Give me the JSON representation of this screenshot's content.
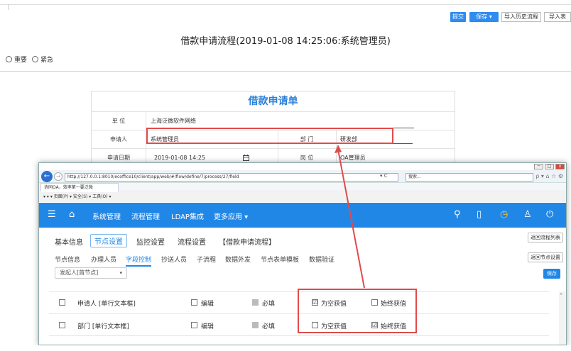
{
  "toolbar": {
    "submit": "提交",
    "save": "保存",
    "save_caret": "▾",
    "import_history": "导入历史流程",
    "import_next": "导入表"
  },
  "page": {
    "title": "借款申请流程(2019-01-08 14:25:06:系统管理员)",
    "radio_important": "重要",
    "radio_urgent": "紧急"
  },
  "form": {
    "heading": "借款申请单",
    "unit_label": "单  位",
    "unit_value": "上海泛微软件网络",
    "applicant_label": "申请人",
    "applicant_value": "系统管理员",
    "dept_label": "部  门",
    "dept_value": "研发部",
    "date_label": "申请日期",
    "date_value": "2019-01-08 14:25",
    "post_label": "岗  位",
    "post_value": "OA管理员"
  },
  "browser": {
    "url": "http://127.0.0.1:8010/ecoffice10/client/app/web/#/flow/define/7/process/27/field",
    "url_tools": "▾ C",
    "search": "搜索...",
    "search_tools": "ρ ▾",
    "tab_title": "协同OA，效率第一要泛微",
    "menu": "▾  ▾  ▾  页面(P) ▾  安全(S) ▾  工具(O) ▾",
    "win_min": "─",
    "win_max": "□",
    "win_close": "x"
  },
  "navbar": {
    "items": [
      "系统管理",
      "流程管理",
      "LDAP集成",
      "更多应用 ▾"
    ],
    "home_icon": "home-icon",
    "menu_icon": "menu-icon"
  },
  "tabs1": {
    "items": [
      "基本信息",
      "节点设置",
      "监控设置",
      "流程设置",
      "【借款申请流程】"
    ],
    "return_list": "返回流程列表",
    "return_node": "返回节点设置"
  },
  "tabs2": {
    "items": [
      "节点信息",
      "办理人员",
      "字段控制",
      "抄送人员",
      "子流程",
      "数据外发",
      "节点表单模板",
      "数据验证"
    ]
  },
  "node_select": "发起人[首节点]",
  "save_btn": "保存",
  "grid": {
    "rows": [
      {
        "field": "申请人 [单行文本框]",
        "edit": "编辑",
        "required": "必填",
        "empty": "为空获值",
        "always": "始终获值",
        "empty_checked": "☑",
        "always_checked": ""
      },
      {
        "field": "部门 [单行文本框]",
        "edit": "编辑",
        "required": "必填",
        "empty": "为空获值",
        "always": "始终获值",
        "empty_checked": "",
        "always_checked": "☑"
      }
    ]
  },
  "colors": {
    "accent": "#2187e7",
    "highlight": "#e24a4a",
    "form_title": "#2a7fd8"
  }
}
